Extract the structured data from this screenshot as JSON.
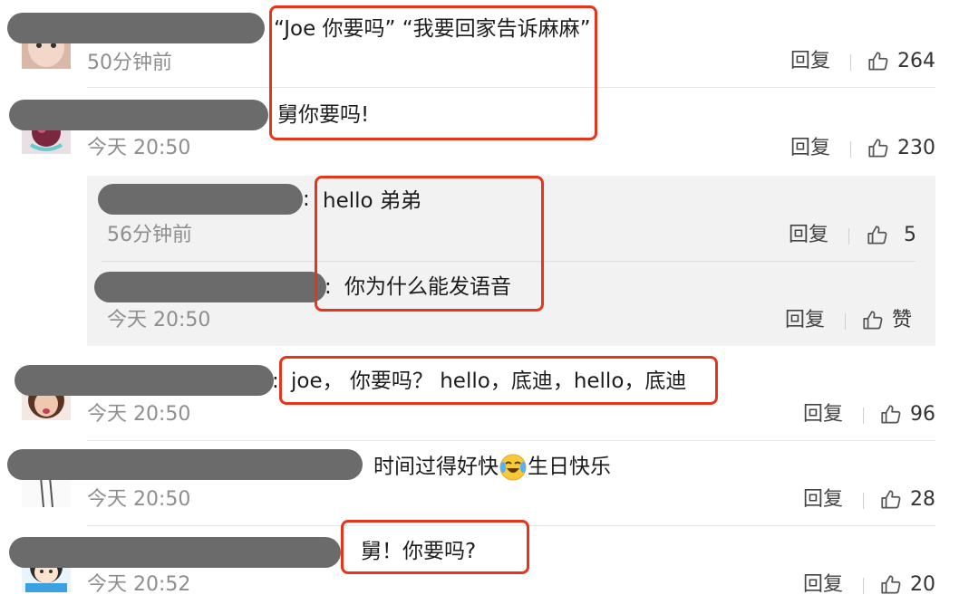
{
  "reply_label": "回复",
  "comments": [
    {
      "text": "“Joe 你要吗” “我要回家告诉麻麻”",
      "time": "50分钟前",
      "likes": "264"
    },
    {
      "text": "舅你要吗!",
      "time": "今天 20:50",
      "likes": "230"
    },
    {
      "text": "joe， 你要吗？ hello，底迪，hello，底迪",
      "time": "今天 20:50",
      "likes": "96"
    },
    {
      "text": "时间过得好快",
      "text_after": "生日快乐",
      "time": "今天 20:50",
      "likes": "28"
    },
    {
      "text": "舅！你要吗?",
      "time": "今天 20:52",
      "likes": "20"
    }
  ],
  "replies": [
    {
      "text": "hello 弟弟",
      "time": "56分钟前",
      "likes": "5"
    },
    {
      "text": "你为什么能发语音",
      "time": "今天 20:50",
      "likes": "赞"
    }
  ],
  "colors": {
    "highlight": "#e5361c",
    "name_redaction": "#6b6b6b",
    "sub_panel": "#f2f2f2"
  },
  "emoji": "laughing-crying-emoji"
}
